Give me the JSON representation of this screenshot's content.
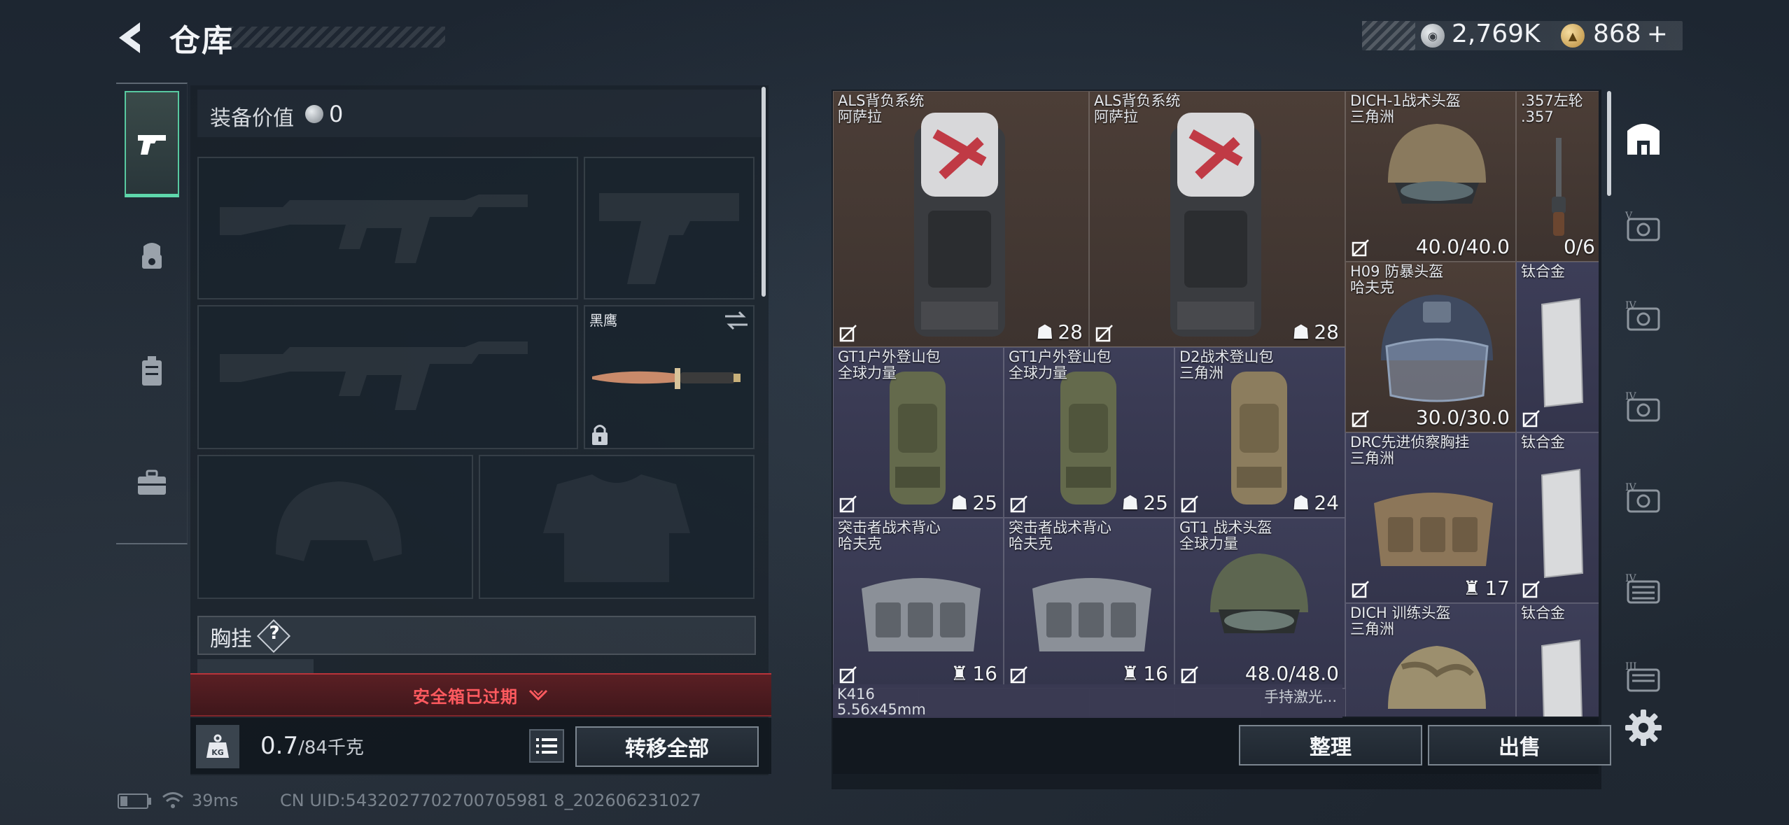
{
  "header": {
    "title": "仓库",
    "silver_amount": "2,769K",
    "gold_amount": "868",
    "gold_add": "+"
  },
  "left_tabs": [
    {
      "name": "weapons",
      "icon": "pistol-icon",
      "active": true
    },
    {
      "name": "gear",
      "icon": "helmet-icon"
    },
    {
      "name": "bag",
      "icon": "backpack-icon"
    },
    {
      "name": "case",
      "icon": "briefcase-icon"
    }
  ],
  "equipment": {
    "value_label": "装备价值",
    "value": "0",
    "melee_name": "黑鹰",
    "chest_label": "胸挂",
    "chest_help": "?",
    "safe_box_text": "安全箱已过期",
    "weight_current": "0.7",
    "weight_max": "/84千克",
    "transfer_all": "转移全部"
  },
  "status": {
    "ping": "39ms",
    "uid": "CN UID:5432027702700705981 8_202606231027"
  },
  "stash": {
    "items": [
      {
        "name": "ALS背负系统",
        "sub": "阿萨拉",
        "stat": "28",
        "stat_icon": "capacity-icon",
        "type": "backpack-red"
      },
      {
        "name": "ALS背负系统",
        "sub": "阿萨拉",
        "stat": "28",
        "stat_icon": "capacity-icon",
        "type": "backpack-red"
      },
      {
        "name": "DICH-1战术头盔",
        "sub": "三角洲",
        "stat": "40.0/40.0",
        "type": "helmet"
      },
      {
        "name": ".357左轮",
        "sub": ".357",
        "stat": "0/6",
        "type": "revolver"
      },
      {
        "name": "H09 防暴头盔",
        "sub": "哈夫克",
        "stat": "30.0/30.0",
        "type": "riot-helmet"
      },
      {
        "name": "钛合金",
        "sub": "",
        "stat": "",
        "type": "plate"
      },
      {
        "name": "GT1户外登山包",
        "sub": "全球力量",
        "stat": "25",
        "stat_icon": "capacity-icon",
        "type": "backpack-green"
      },
      {
        "name": "GT1户外登山包",
        "sub": "全球力量",
        "stat": "25",
        "stat_icon": "capacity-icon",
        "type": "backpack-green"
      },
      {
        "name": "D2战术登山包",
        "sub": "三角洲",
        "stat": "24",
        "stat_icon": "capacity-icon",
        "type": "backpack-tan"
      },
      {
        "name": "DRC先进侦察胸挂",
        "sub": "三角洲",
        "stat": "17",
        "stat_icon": "vest-capacity-icon",
        "type": "chest-rig"
      },
      {
        "name": "钛合金",
        "sub": "",
        "stat": "",
        "type": "plate"
      },
      {
        "name": "突击者战术背心",
        "sub": "哈夫克",
        "stat": "16",
        "stat_icon": "vest-capacity-icon",
        "type": "vest"
      },
      {
        "name": "突击者战术背心",
        "sub": "哈夫克",
        "stat": "16",
        "stat_icon": "vest-capacity-icon",
        "type": "vest"
      },
      {
        "name": "GT1 战术头盔",
        "sub": "全球力量",
        "stat": "48.0/48.0",
        "type": "helmet-green"
      },
      {
        "name": "DICH 训练头盔",
        "sub": "三角洲",
        "stat": "",
        "type": "helmet-camo"
      },
      {
        "name": "钛合金",
        "sub": "",
        "stat": "",
        "type": "plate"
      }
    ],
    "partial_name": "K416",
    "partial_sub": "5.56x45mm",
    "partial_right": "手持激光...",
    "sort_label": "整理",
    "sell_label": "出售"
  },
  "right_tabs": [
    {
      "name": "all",
      "icon": "all-items-icon",
      "label": ""
    },
    {
      "name": "tier",
      "icon": "gear-v-icon",
      "label": "V"
    },
    {
      "name": "tier",
      "icon": "gear-iv-icon",
      "label": "IV"
    },
    {
      "name": "tier",
      "icon": "gear-iv-icon",
      "label": "IV"
    },
    {
      "name": "tier",
      "icon": "gear-iv-icon",
      "label": "IV"
    },
    {
      "name": "tier",
      "icon": "gear-iv-icon",
      "label": "IV"
    },
    {
      "name": "tier",
      "icon": "gear-iii-icon",
      "label": "III"
    }
  ],
  "colors": {
    "accent_green": "#5fd7ab",
    "alert_red": "#ff5a5f",
    "item_red": "#4c3e37",
    "item_purple": "#3d3e58"
  }
}
